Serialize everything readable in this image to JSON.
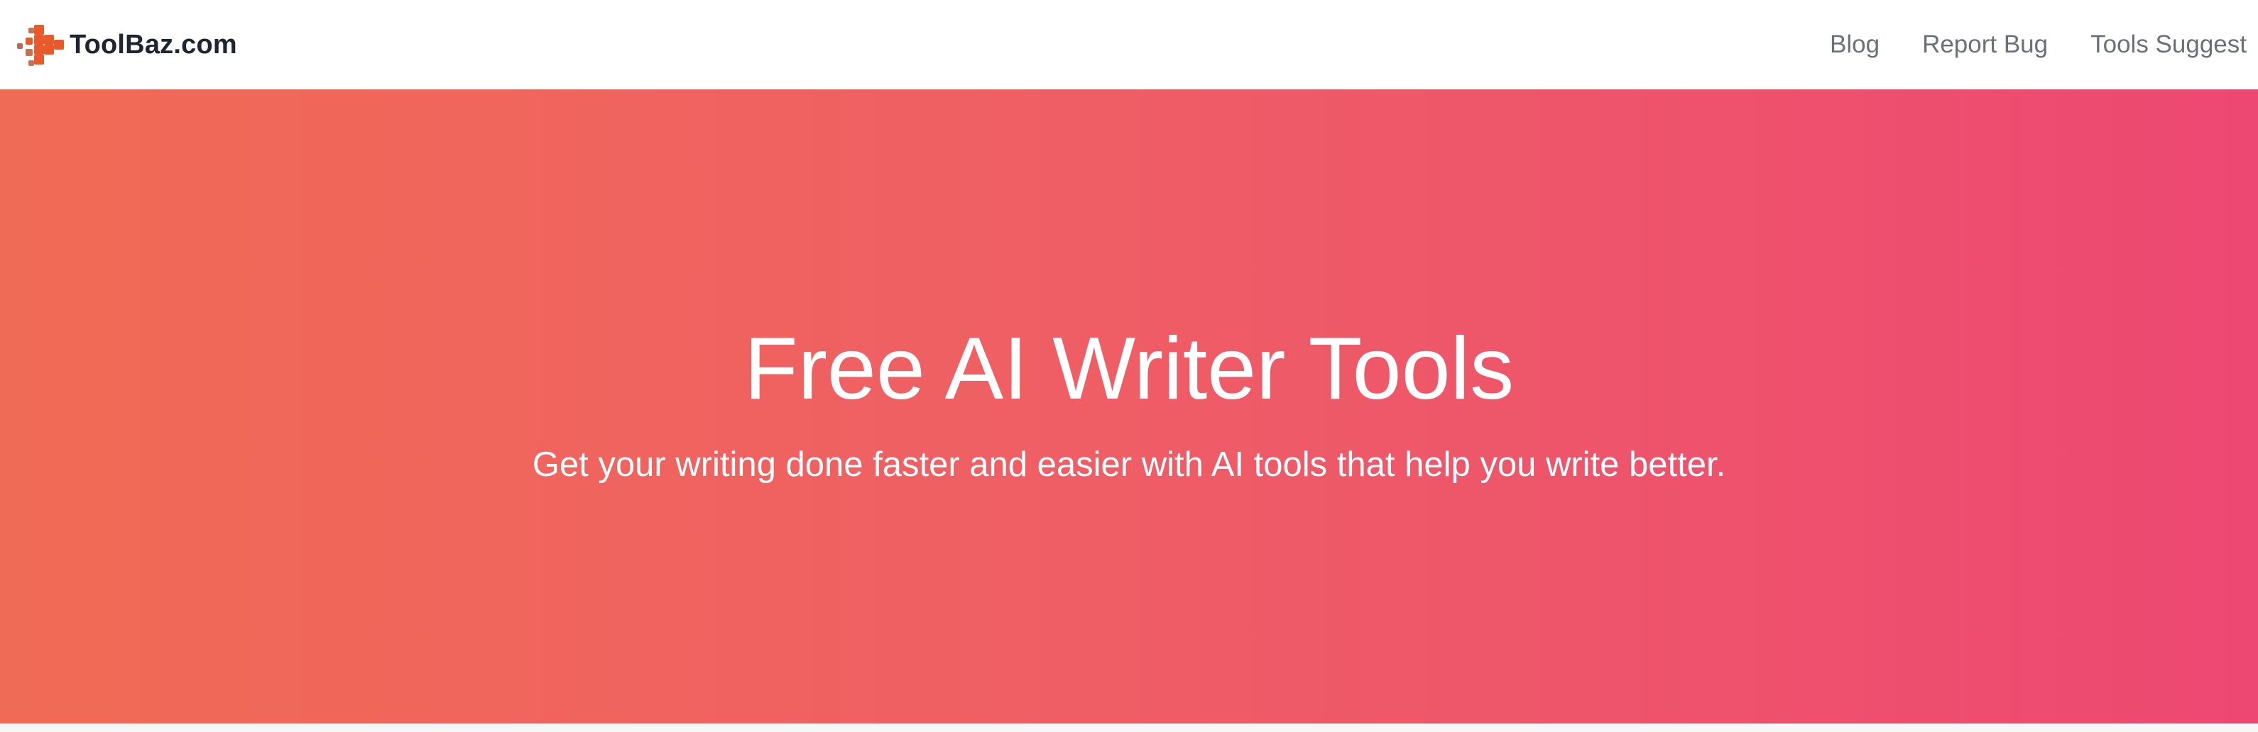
{
  "navbar": {
    "brand": "ToolBaz.com",
    "logo_icon": "plus-pixel-logo-icon",
    "links": [
      {
        "label": "Blog"
      },
      {
        "label": "Report Bug"
      },
      {
        "label": "Tools Suggest"
      }
    ]
  },
  "hero": {
    "title": "Free AI Writer Tools",
    "subtitle": "Get your writing done faster and easier with AI tools that help you write better.",
    "gradient_start": "#f06b55",
    "gradient_end": "#ed4872"
  },
  "colors": {
    "logo_orange": "#e8592b",
    "logo_brown": "#b86a5a",
    "text_dark": "#1f2530",
    "link_gray": "#6b7078"
  }
}
